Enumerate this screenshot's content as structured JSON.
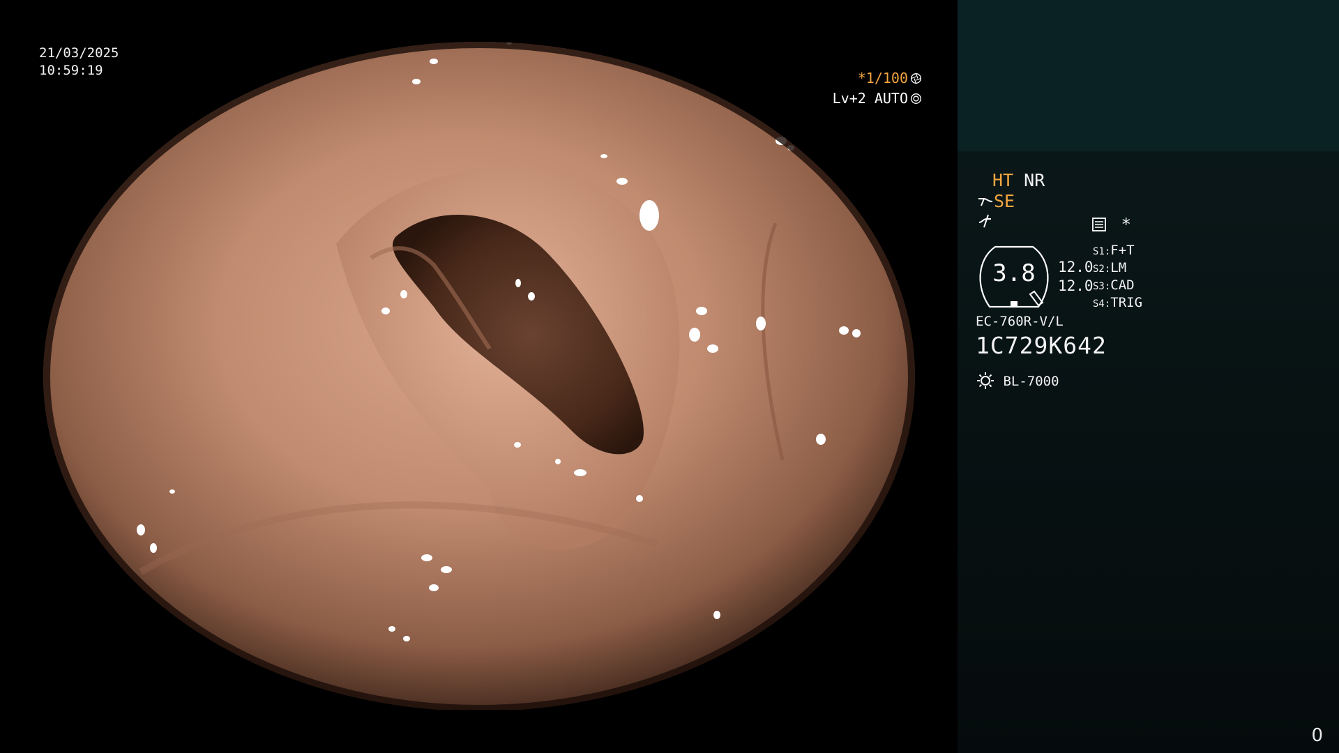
{
  "osd": {
    "date": "21/03/2025",
    "time": "10:59:19",
    "shutter": "*1/100",
    "shutter_icon": "aperture-icon",
    "level": "Lv+2",
    "iris_mode": "AUTO",
    "iris_icon": "iris-icon"
  },
  "panel": {
    "mode_ht": "HT",
    "mode_nr": "NR",
    "enhance": "SE",
    "enhance_icon": "structure-enhance-icon",
    "filter_icon": "noise-filter-icon",
    "record_icon": "record-list-icon",
    "star": "*",
    "zoom_value": "3.8",
    "value_top": "12.0",
    "value_bottom": "12.0",
    "slots": [
      {
        "key": "S1:",
        "value": "F+T"
      },
      {
        "key": "S2:",
        "value": "LM"
      },
      {
        "key": "S3:",
        "value": "CAD"
      },
      {
        "key": "S4:",
        "value": "TRIG"
      }
    ],
    "scope_model": "EC-760R-V/L",
    "serial": "1C729K642",
    "light_icon": "light-source-icon",
    "light_source": "BL-7000",
    "frame_counter": "0"
  },
  "colors": {
    "accent_orange": "#f4a640",
    "panel_top": "#0b2224",
    "panel_bg": "#060f10",
    "mucosa": "#b8836a",
    "lumen": "#4a2a1c"
  }
}
